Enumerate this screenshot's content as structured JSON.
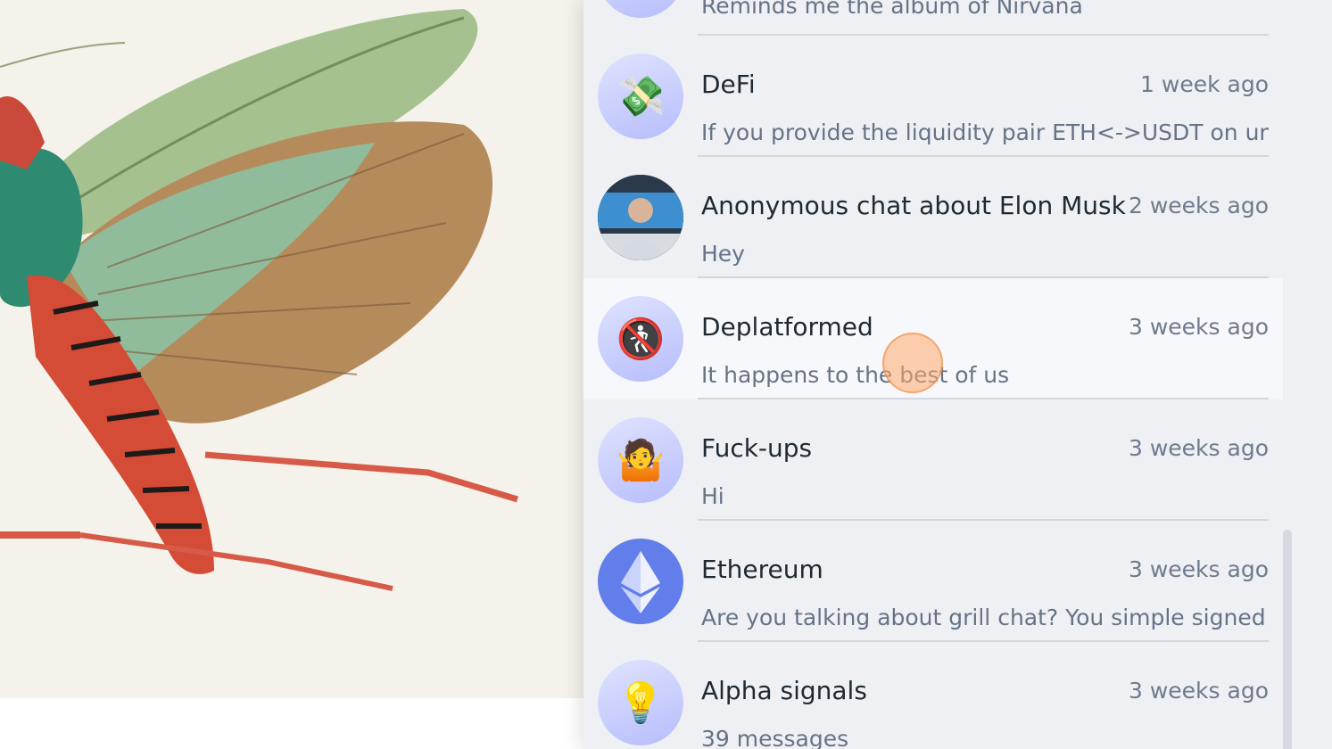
{
  "chats": [
    {
      "title": "",
      "time": "",
      "preview": "Reminds me the album of Nirvana",
      "avatar_icon": "album-icon"
    },
    {
      "title": "DeFi",
      "time": "1 week ago",
      "preview": "If you provide the liquidity pair ETH<->USDT on uniswa",
      "avatar_icon": "money-wings-icon",
      "glyph": "💸"
    },
    {
      "title": "Anonymous chat about Elon Musk",
      "time": "2 weeks ago",
      "preview": "Hey",
      "avatar_icon": "person-photo-icon"
    },
    {
      "title": "Deplatformed",
      "time": "3 weeks ago",
      "preview": "It happens to the best of us",
      "avatar_icon": "no-pedestrians-icon",
      "glyph": "🚷"
    },
    {
      "title": "Fuck-ups",
      "time": "3 weeks ago",
      "preview": "Hi",
      "avatar_icon": "person-shrugging-icon",
      "glyph": "🤷"
    },
    {
      "title": "Ethereum",
      "time": "3 weeks ago",
      "preview": "Are you talking about grill chat? You simple signed a me",
      "avatar_icon": "ethereum-icon"
    },
    {
      "title": "Alpha signals",
      "time": "3 weeks ago",
      "preview": "39 messages",
      "avatar_icon": "light-bulb-icon",
      "glyph": "💡"
    }
  ],
  "colors": {
    "panel_bg": "#eef0f4",
    "active_row_bg": "#f7f8fb",
    "avatar_gradient": "#b7bdfb",
    "ethereum": "#627eea",
    "cursor_highlight": "#ffaa6e"
  }
}
